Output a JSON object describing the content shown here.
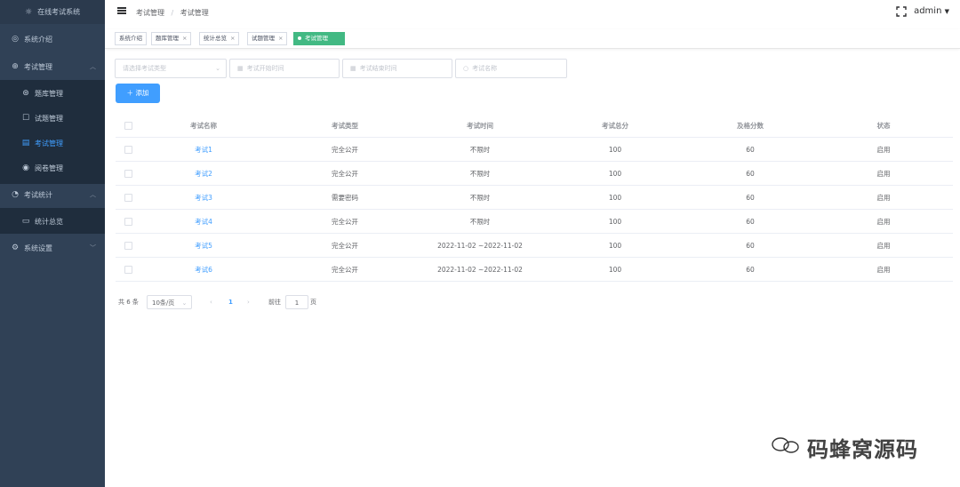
{
  "app": {
    "title": "在线考试系统"
  },
  "sidebar": {
    "items": [
      {
        "label": "系统介绍",
        "icon": "info-icon"
      },
      {
        "label": "考试管理",
        "icon": "globe-icon",
        "expanded": true
      },
      {
        "label": "题库管理",
        "icon": "bank-icon",
        "sub": true
      },
      {
        "label": "试题管理",
        "icon": "edit-icon",
        "sub": true
      },
      {
        "label": "考试管理",
        "icon": "doc-icon",
        "sub": true,
        "active": true
      },
      {
        "label": "阅卷管理",
        "icon": "eye-icon",
        "sub": true
      },
      {
        "label": "考试统计",
        "icon": "pie-icon",
        "expanded": true
      },
      {
        "label": "统计总览",
        "icon": "monitor-icon",
        "sub": true
      },
      {
        "label": "系统设置",
        "icon": "gear-icon"
      }
    ]
  },
  "header": {
    "breadcrumb": [
      "考试管理",
      "考试管理"
    ],
    "user": "admin"
  },
  "tags": [
    {
      "label": "系统介绍",
      "closable": false
    },
    {
      "label": "题库管理",
      "closable": true
    },
    {
      "label": "统计总览",
      "closable": true
    },
    {
      "label": "试题管理",
      "closable": true
    },
    {
      "label": "考试管理",
      "closable": false,
      "active": true
    }
  ],
  "filters": {
    "type_placeholder": "请选择考试类型",
    "start_placeholder": "考试开始时间",
    "end_placeholder": "考试结束时间",
    "name_placeholder": "考试名称"
  },
  "add_button": "添加",
  "table": {
    "headers": [
      "考试名称",
      "考试类型",
      "考试时间",
      "考试总分",
      "及格分数",
      "状态"
    ],
    "rows": [
      [
        "考试1",
        "完全公开",
        "不限时",
        "100",
        "60",
        "启用"
      ],
      [
        "考试2",
        "完全公开",
        "不限时",
        "100",
        "60",
        "启用"
      ],
      [
        "考试3",
        "需要密码",
        "不限时",
        "100",
        "60",
        "启用"
      ],
      [
        "考试4",
        "完全公开",
        "不限时",
        "100",
        "60",
        "启用"
      ],
      [
        "考试5",
        "完全公开",
        "2022-11-02 ~2022-11-02",
        "100",
        "60",
        "启用"
      ],
      [
        "考试6",
        "完全公开",
        "2022-11-02 ~2022-11-02",
        "100",
        "60",
        "启用"
      ]
    ]
  },
  "pagination": {
    "total": "共 6 条",
    "page_size": "10条/页",
    "current": "1",
    "goto_label": "前往",
    "goto_value": "1",
    "page_unit": "页"
  },
  "watermark": "码蜂窝源码",
  "colors": {
    "sidebar": "#304156",
    "accent": "#409eff",
    "tag_active": "#42b983"
  }
}
